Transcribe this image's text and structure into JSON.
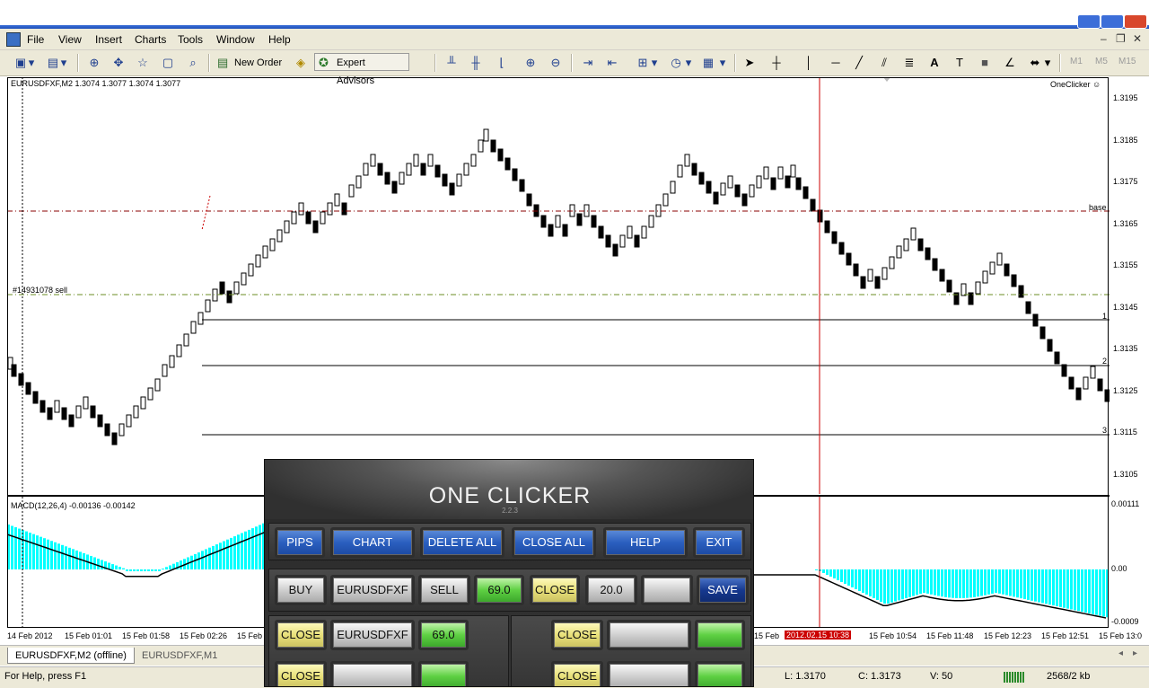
{
  "menu": [
    "File",
    "View",
    "Insert",
    "Charts",
    "Tools",
    "Window",
    "Help"
  ],
  "toolbar": {
    "new_order": "New Order",
    "expert_advisors": "Expert Advisors",
    "timeframes": [
      "M1",
      "M5",
      "M15"
    ]
  },
  "chart": {
    "header": "EURUSDFXF,M2  1.3074 1.3077 1.3074 1.3077",
    "ea_label": "OneClicker",
    "order_label": "#14931078 sell",
    "base_label": "base",
    "level_labels": [
      "1",
      "2",
      "3"
    ],
    "price_ticks": [
      "1.3195",
      "1.3185",
      "1.3175",
      "1.3165",
      "1.3155",
      "1.3145",
      "1.3135",
      "1.3125",
      "1.3115",
      "1.3105"
    ],
    "macd_header": "MACD(12,26,4) -0.00136 -0.00142",
    "macd_ticks": [
      "0.00111",
      "0.00",
      "-0.0009"
    ],
    "time_labels": [
      "14 Feb 2012",
      "15 Feb 01:01",
      "15 Feb 01:58",
      "15 Feb 02:26",
      "15 Feb",
      "15 Feb",
      "15 Feb 10:54",
      "15 Feb 11:48",
      "15 Feb 12:23",
      "15 Feb 12:51",
      "15 Feb 13:0"
    ],
    "cursor_time": "2012.02.15 10:38",
    "colors": {
      "up": "#ffffff",
      "down": "#000000",
      "macd_hist": "#00ffff",
      "cursor": "#cc0000"
    }
  },
  "tabs": [
    "EURUSDFXF,M2 (offline)",
    "EURUSDFXF,M1"
  ],
  "status": {
    "help": "For Help, press F1",
    "low": "L: 1.3170",
    "close": "C: 1.3173",
    "volume": "V: 50",
    "traffic": "2568/2 kb"
  },
  "oneclicker": {
    "title": "ONE CLICKER",
    "version": "2.2.3",
    "top_buttons": [
      "PIPS",
      "CHART",
      "DELETE ALL",
      "CLOSE ALL",
      "HELP",
      "EXIT"
    ],
    "trade_row": {
      "buy": "BUY",
      "symbol": "EURUSDFXF",
      "sell": "SELL",
      "lots": "69.0",
      "close": "CLOSE",
      "value": "20.0",
      "save": "SAVE"
    },
    "pos_row1": {
      "close": "CLOSE",
      "symbol": "EURUSDFXF",
      "value": "69.0",
      "close_right": "CLOSE"
    },
    "pos_row2": {
      "close": "CLOSE",
      "close_right": "CLOSE"
    }
  }
}
